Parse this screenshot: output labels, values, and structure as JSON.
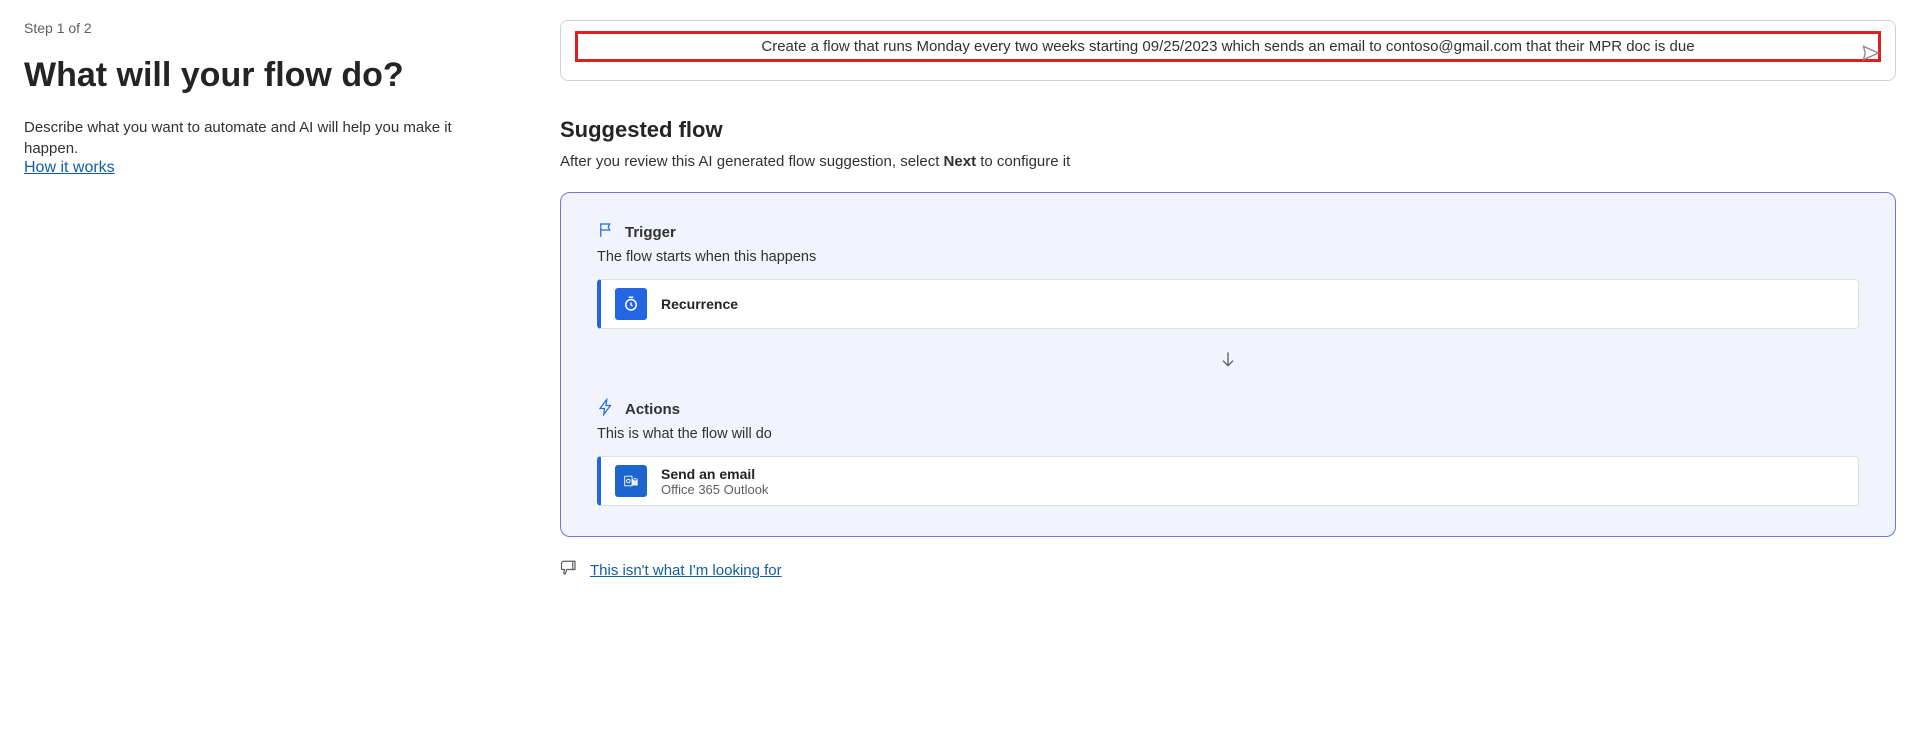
{
  "left": {
    "step": "Step 1 of 2",
    "heading": "What will your flow do?",
    "description": "Describe what you want to automate and AI will help you make it happen.",
    "howItWorks": "How it works"
  },
  "prompt": {
    "text": "Create a flow that runs Monday every two weeks starting 09/25/2023 which sends an email to contoso@gmail.com that their MPR doc is due"
  },
  "suggested": {
    "title": "Suggested flow",
    "sub_before": "After you review this AI generated flow suggestion, select ",
    "sub_bold": "Next",
    "sub_after": " to configure it"
  },
  "trigger": {
    "label": "Trigger",
    "desc": "The flow starts when this happens",
    "card_title": "Recurrence"
  },
  "actions": {
    "label": "Actions",
    "desc": "This is what the flow will do",
    "card_title": "Send an email",
    "card_sub": "Office 365 Outlook"
  },
  "feedback": {
    "link": "This isn't what I'm looking for"
  }
}
